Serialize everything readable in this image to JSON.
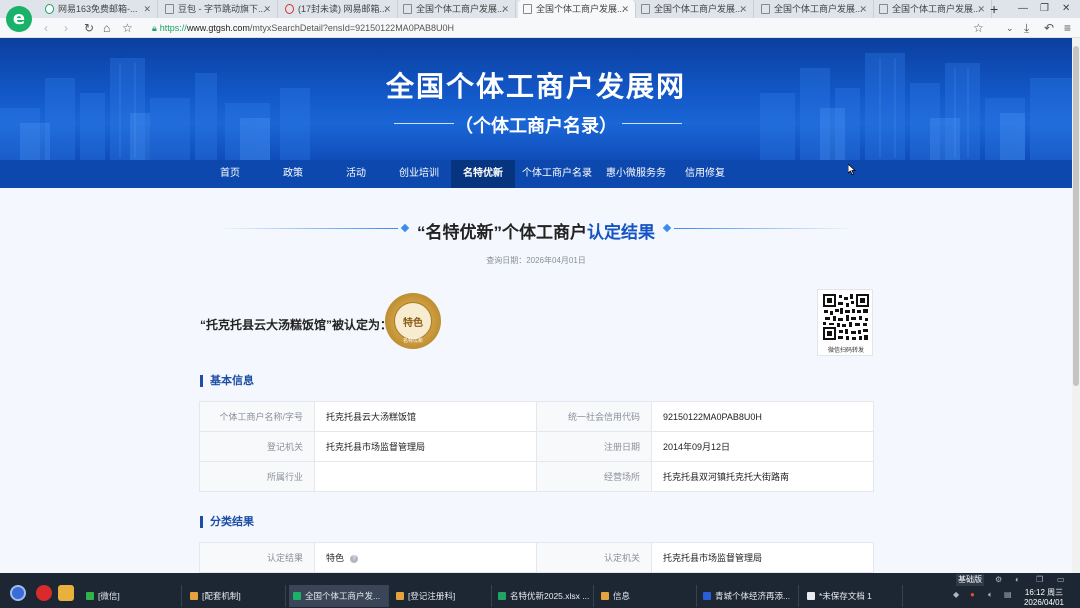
{
  "browser": {
    "tabs": [
      {
        "label": "网易163免费邮箱-...",
        "icon": "green"
      },
      {
        "label": "豆包 - 字节跳动旗下...",
        "icon": "doc"
      },
      {
        "label": "(17封未读) 网易邮箱...",
        "icon": "red"
      },
      {
        "label": "全国个体工商户发展...",
        "icon": "page"
      },
      {
        "label": "全国个体工商户发展...",
        "icon": "page"
      },
      {
        "label": "全国个体工商户发展...",
        "icon": "page"
      },
      {
        "label": "全国个体工商户发展...",
        "icon": "page"
      },
      {
        "label": "全国个体工商户发展...",
        "icon": "page"
      },
      {
        "label": "全国个体工商户发展...",
        "icon": "page"
      }
    ],
    "url_scheme": "https://",
    "url_host": "www.gtgsh.com",
    "url_path": "/mtyxSearchDetail?ensId=92150122MA0PAB8U0H"
  },
  "site": {
    "title": "全国个体工商户发展网",
    "subtitle": "（个体工商户名录）",
    "nav": [
      "首页",
      "政策",
      "活动",
      "创业培训",
      "名特优新",
      "个体工商户名录",
      "惠小微服务务",
      "信用修复"
    ],
    "nav_active": 4
  },
  "result": {
    "heading_prefix": "“名特优新”个体工商户",
    "heading_highlight": "认定结果",
    "query_date": "查询日期：2026年04月01日",
    "certified_text": "“托克托县云大汤糕饭馆”被认定为：",
    "badge_text": "特色",
    "badge_ring": "名特优新",
    "qr_caption": "微信扫码转发"
  },
  "basic_info": {
    "title": "基本信息",
    "rows": [
      [
        {
          "k": "个体工商户名称/字号",
          "v": "托克托县云大汤糕饭馆"
        },
        {
          "k": "统一社会信用代码",
          "v": "92150122MA0PAB8U0H"
        }
      ],
      [
        {
          "k": "登记机关",
          "v": "托克托县市场监督管理局"
        },
        {
          "k": "注册日期",
          "v": "2014年09月12日"
        }
      ],
      [
        {
          "k": "所属行业",
          "v": ""
        },
        {
          "k": "经营场所",
          "v": "托克托县双河镇托克托大街路南"
        }
      ]
    ]
  },
  "classification": {
    "title": "分类结果",
    "rows": [
      [
        {
          "k": "认定结果",
          "v": "特色"
        },
        {
          "k": "认定机关",
          "v": "托克托县市场监督管理局"
        }
      ]
    ]
  },
  "taskbar": {
    "items": [
      {
        "label": "[微信]",
        "color": "#2fb34a"
      },
      {
        "label": "[配套机制]",
        "color": "#e6a23c"
      },
      {
        "label": "全国个体工商户发...",
        "color": "#19b26b"
      },
      {
        "label": "[登记注册科]",
        "color": "#e6a23c"
      },
      {
        "label": "名特优新2025.xlsx ...",
        "color": "#21a366"
      },
      {
        "label": "信息",
        "color": "#e6a23c"
      },
      {
        "label": "青城个体经济再添...",
        "color": "#2b5fd9"
      },
      {
        "label": "*未保存文档 1",
        "color": "#e8ecf2"
      }
    ],
    "ime": "基础版",
    "time": "16:12 周三",
    "date": "2026/04/01"
  }
}
